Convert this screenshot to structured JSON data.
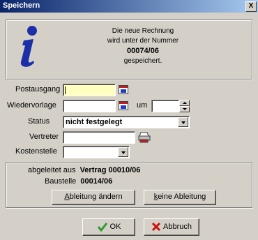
{
  "window": {
    "title": "Speichern",
    "close_label": "X"
  },
  "message": {
    "line1": "Die neue Rechnung",
    "line2": "wird unter der Nummer",
    "number": "00074/06",
    "line4": "gespeichert."
  },
  "form": {
    "postausgang_label": "Postausgang",
    "postausgang_value": "",
    "wiedervorlage_label": "Wiedervorlage",
    "wiedervorlage_value": "",
    "um_label": "um",
    "time_value": "",
    "status_label": "Status",
    "status_value": "nicht festgelegt",
    "vertreter_label": "Vertreter",
    "vertreter_value": "",
    "kostenstelle_label": "Kostenstelle",
    "kostenstelle_value": ""
  },
  "derivation": {
    "prefix": "abgeleitet aus",
    "source": "Vertrag 00010/06",
    "baustelle_label": "Baustelle",
    "baustelle_value": "00014/06",
    "change_first": "A",
    "change_rest": "bleitung ändern",
    "none_pre": "",
    "none_first": "k",
    "none_rest": "eine Ableitung"
  },
  "buttons": {
    "ok": "OK",
    "cancel": "Abbruch"
  },
  "colors": {
    "titlebar_start": "#0a246a",
    "titlebar_end": "#a6caf0",
    "highlight_field": "#ffffc0",
    "info_icon": "#1c2fa8",
    "ok_check": "#2e9a2e",
    "cancel_x": "#cc1010"
  },
  "icons": [
    "info-icon",
    "calendar-icon",
    "printer-icon",
    "check-icon",
    "x-icon"
  ]
}
